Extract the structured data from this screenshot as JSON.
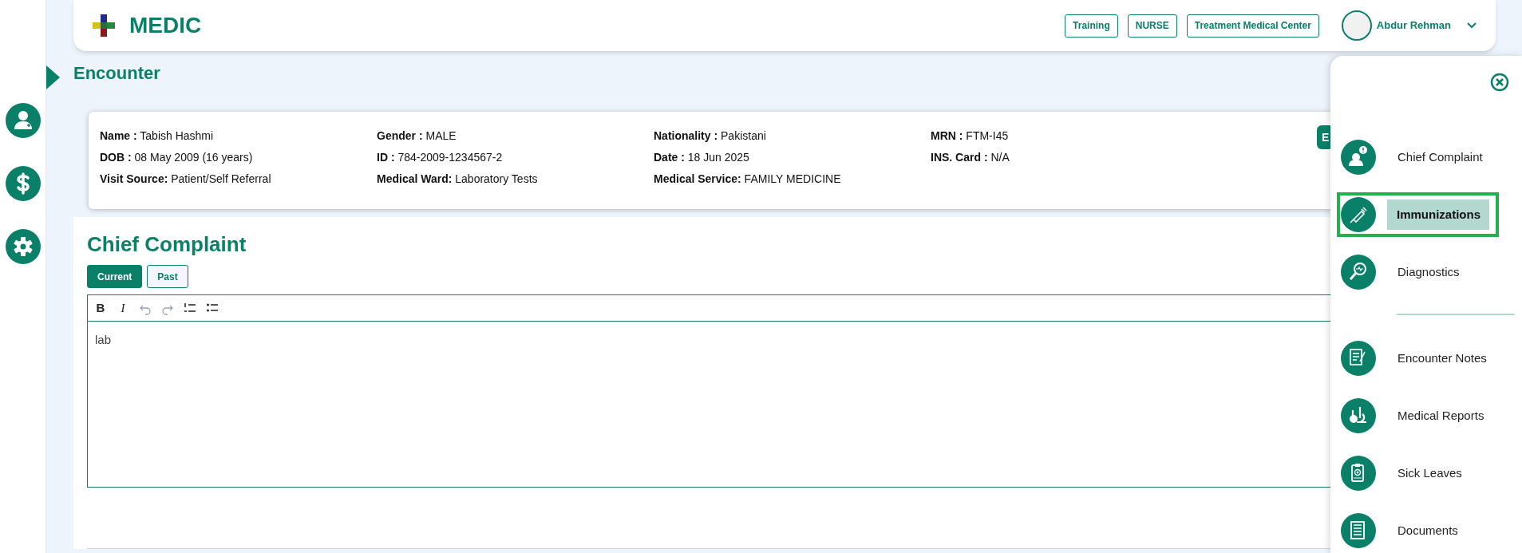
{
  "header": {
    "logo_text": "MEDIC",
    "badges": [
      "Training",
      "NURSE",
      "Treatment Medical Center"
    ],
    "user_name": "Abdur Rehman"
  },
  "page_title": "Encounter",
  "patient": {
    "rows": [
      [
        {
          "label": "Name :",
          "value": "Tabish Hashmi"
        },
        {
          "label": "Gender :",
          "value": "MALE"
        },
        {
          "label": "Nationality :",
          "value": "Pakistani"
        },
        {
          "label": "MRN :",
          "value": "FTM-I45"
        }
      ],
      [
        {
          "label": "DOB :",
          "value": "08 May 2009 (16 years)"
        },
        {
          "label": "ID :",
          "value": "784-2009-1234567-2"
        },
        {
          "label": "Date :",
          "value": "18 Jun 2025"
        },
        {
          "label": "INS. Card :",
          "value": "N/A"
        }
      ],
      [
        {
          "label": "Visit Source:",
          "value": "Patient/Self Referral"
        },
        {
          "label": "Medical Ward:",
          "value": "Laboratory Tests"
        },
        {
          "label": "Medical Service:",
          "value": "FAMILY MEDICINE"
        }
      ]
    ],
    "button": "E"
  },
  "section": {
    "title": "Chief Complaint",
    "tabs": [
      {
        "label": "Current",
        "selected": true
      },
      {
        "label": "Past",
        "selected": false
      }
    ],
    "toolbar": [
      {
        "kind": "bold",
        "label": "B",
        "disabled": false
      },
      {
        "kind": "italic",
        "label": "I",
        "disabled": false
      },
      {
        "kind": "undo",
        "disabled": true
      },
      {
        "kind": "redo",
        "disabled": true
      },
      {
        "kind": "ordered-list",
        "disabled": false
      },
      {
        "kind": "bullet-list",
        "disabled": false
      }
    ],
    "editor_value": "lab"
  },
  "panel": {
    "groups": [
      [
        {
          "kind": "complaint",
          "label": "Chief Complaint",
          "selected": false
        },
        {
          "kind": "syringe",
          "label": "Immunizations",
          "selected": true
        },
        {
          "kind": "magnifier",
          "label": "Diagnostics",
          "selected": false
        }
      ],
      [
        {
          "kind": "notes",
          "label": "Encounter Notes",
          "selected": false
        },
        {
          "kind": "lab",
          "label": "Medical Reports",
          "selected": false
        },
        {
          "kind": "clipboard",
          "label": "Sick Leaves",
          "selected": false
        },
        {
          "kind": "documents",
          "label": "Documents",
          "selected": false
        }
      ]
    ]
  }
}
